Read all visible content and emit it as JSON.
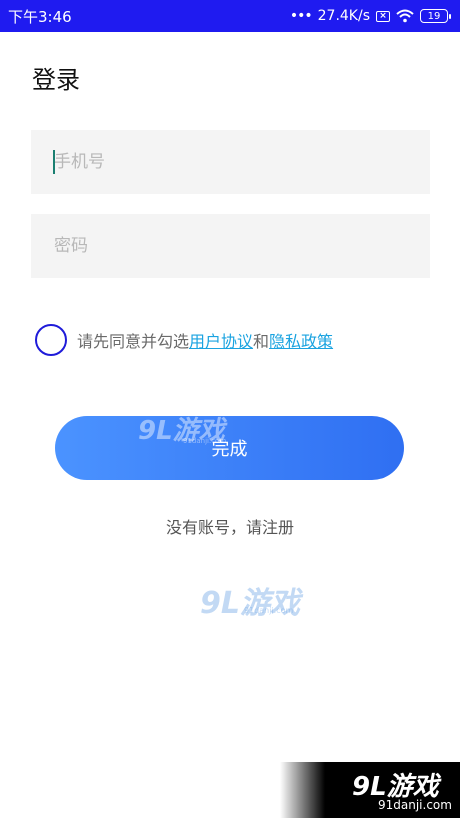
{
  "status_bar": {
    "time": "下午3:46",
    "speed": "27.4K/s",
    "battery": "19"
  },
  "page": {
    "title": "登录"
  },
  "form": {
    "phone_placeholder": "手机号",
    "password_placeholder": "密码",
    "agreement_prefix": "请先同意并勾选",
    "agreement_link_1": "用户协议",
    "agreement_and": "和",
    "agreement_link_2": "隐私政策",
    "agreement_checked": false,
    "submit_label": "完成",
    "register_label": "没有账号，请注册"
  },
  "watermark": {
    "logo": "9L游戏",
    "domain": "91danji.com"
  },
  "colors": {
    "status_bar": "#1f1bf0",
    "button_start": "#4b93ff",
    "button_end": "#2f6ff2",
    "link": "#1aa3e0",
    "radio_border": "#1f1bd9"
  }
}
